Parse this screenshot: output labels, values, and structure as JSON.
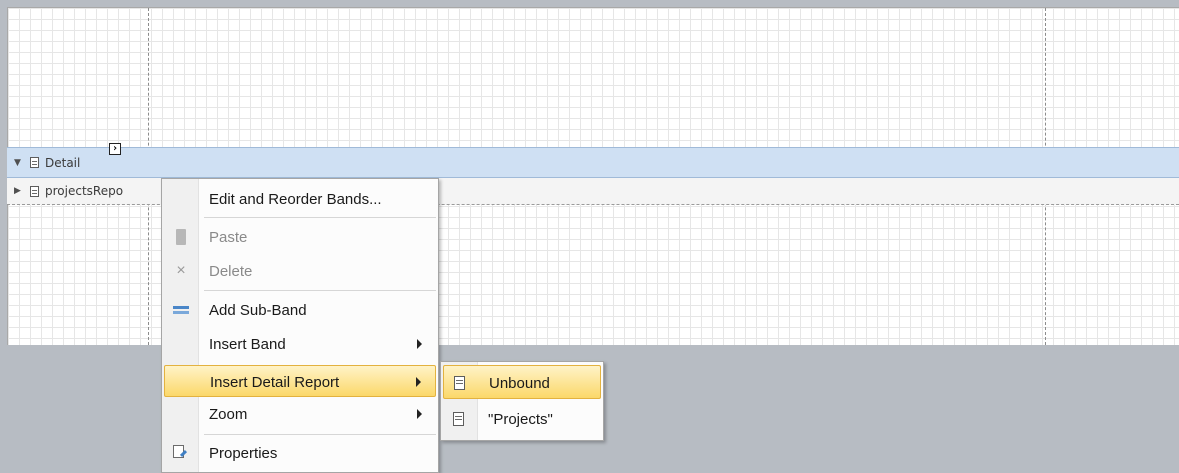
{
  "bands": {
    "detail": {
      "label": "Detail",
      "expanded": true
    },
    "sub_report": {
      "label": "projectsRepo",
      "expanded": false
    }
  },
  "smart_tag": {
    "glyph": "›",
    "icon": "smart-tag-icon"
  },
  "context_menu": {
    "items": [
      {
        "label": "Edit and Reorder Bands...",
        "icon": "",
        "disabled": false
      },
      {
        "label": "Paste",
        "icon": "paste-icon",
        "disabled": true
      },
      {
        "label": "Delete",
        "icon": "delete-icon",
        "glyph": "×",
        "disabled": true
      },
      {
        "label": "Add Sub-Band",
        "icon": "sub-band-icon",
        "disabled": false
      },
      {
        "label": "Insert Band",
        "icon": "",
        "has_submenu": true
      },
      {
        "label": "Insert Detail Report",
        "icon": "",
        "has_submenu": true,
        "highlighted": true
      },
      {
        "label": "Zoom",
        "icon": "",
        "has_submenu": true
      },
      {
        "label": "Properties",
        "icon": "properties-icon",
        "disabled": false
      }
    ]
  },
  "submenu": {
    "items": [
      {
        "label": "Unbound",
        "icon": "report-icon",
        "highlighted": true
      },
      {
        "label": "\"Projects\"",
        "icon": "report-icon",
        "highlighted": false
      }
    ]
  },
  "colors": {
    "highlight": "#fbd86a",
    "band_selected": "#cfe0f3",
    "background": "#b7bcc3"
  }
}
